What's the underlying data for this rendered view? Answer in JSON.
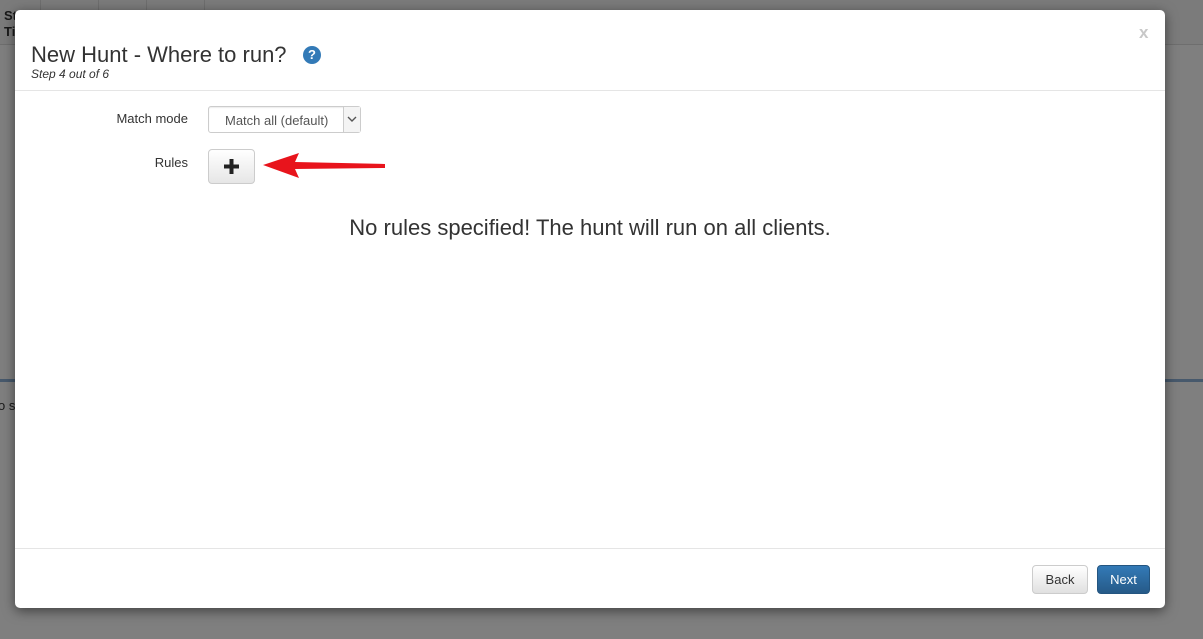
{
  "background": {
    "header_columns": [
      "St Ti"
    ],
    "side_text": "o s"
  },
  "modal": {
    "title": "New Hunt - Where to run?",
    "help_icon": "question-circle-icon",
    "subtitle": "Step 4 out of 6",
    "close_label": "x"
  },
  "form": {
    "match_mode": {
      "label": "Match mode",
      "value": "Match all (default)"
    },
    "rules": {
      "label": "Rules",
      "add_icon": "plus-icon"
    }
  },
  "empty_message": "No rules specified! The hunt will run on all clients.",
  "footer": {
    "back_label": "Back",
    "next_label": "Next"
  },
  "colors": {
    "primary": "#337ab7",
    "annotation_arrow": "#e8141c"
  }
}
